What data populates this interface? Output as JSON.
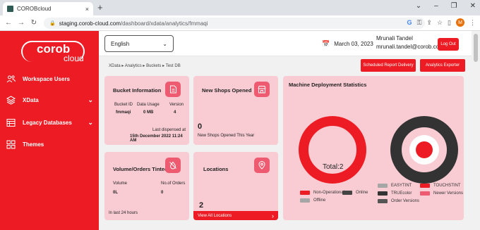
{
  "browser": {
    "tab_title": "COROBcloud",
    "close_glyph": "×",
    "new_tab_glyph": "+",
    "url_host": "staging.corob-cloud.com",
    "url_path": "/dashboard/xdata/analytics/fmmaqi",
    "avatar_letter": "M"
  },
  "brand": {
    "word": "corob",
    "sub": "cloud"
  },
  "sidebar": {
    "items": [
      {
        "label": "Workspace Users",
        "icon": "users-icon",
        "chevron": false
      },
      {
        "label": "XData",
        "icon": "layers-icon",
        "chevron": true
      },
      {
        "label": "Legacy Databases",
        "icon": "table-icon",
        "chevron": true
      },
      {
        "label": "Themes",
        "icon": "grid-icon",
        "chevron": false
      }
    ]
  },
  "header": {
    "language": "English",
    "date": "March 03, 2023",
    "user_name": "Mrunali Tandel",
    "user_email": "mrunali.tandel@corob.com",
    "logout_label": "Log Out"
  },
  "breadcrumb": [
    "XData",
    "Analytics",
    "Buckets",
    "Test DB"
  ],
  "breadcrumb_sep": "▸",
  "actions": {
    "scheduled": "Scheduled Report Delivery",
    "exporter": "Analytics Exporter"
  },
  "bucket": {
    "title": "Bucket Information",
    "headers": [
      "Bucket ID",
      "Data Usage",
      "Version"
    ],
    "values": [
      "fmmaqi",
      "0 MB",
      "4"
    ],
    "last_label": "Last dispensed at",
    "last_value": "15th December 2022 11:24 AM"
  },
  "shops": {
    "title": "New Shops Opened",
    "count": "0",
    "caption": "New Shops Opened This Year"
  },
  "tinted": {
    "title": "Volume/Orders Tinted",
    "col1": "Volume",
    "col2": "No.of Orders",
    "val1": "0L",
    "val2": "0",
    "footer": "In last 24 hours"
  },
  "locations": {
    "title": "Locations",
    "count": "2",
    "link": "View All Locations",
    "link_arrow": "›"
  },
  "machine": {
    "title": "Machine Deployment Statistics",
    "total_label": "Total:2",
    "legend_left": [
      {
        "label": "Non-Operational",
        "color": "#ed1c24"
      },
      {
        "label": "Online",
        "color": "#444444"
      },
      {
        "label": "Offline",
        "color": "#a6a6a6"
      }
    ],
    "legend_right": [
      {
        "label": "EASYTINT",
        "color": "#a6a6a6"
      },
      {
        "label": "TOUCHSTINT",
        "color": "#ed1c24"
      },
      {
        "label": "TRUEcolor",
        "color": "#333333"
      },
      {
        "label": "Newer Versions",
        "color": "#ee5a6f"
      },
      {
        "label": "Order Versions",
        "color": "#555555"
      }
    ]
  },
  "colors": {
    "accent": "#ed1c24",
    "card": "#f9ccd4"
  }
}
